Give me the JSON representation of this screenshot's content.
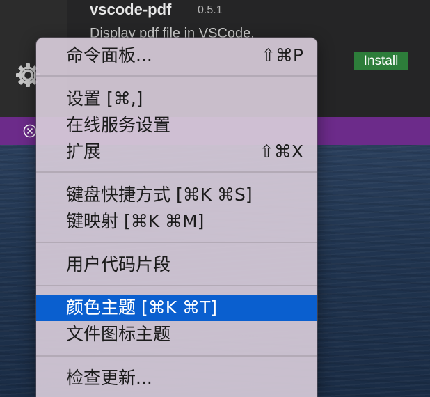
{
  "extension": {
    "name": "vscode-pdf",
    "version": "0.5.1",
    "description": "Display pdf file in VSCode.",
    "install_label": "Install"
  },
  "icons": {
    "gear": "gear-icon",
    "errors": "circle-x-icon"
  },
  "menu": {
    "items": [
      {
        "label": "命令面板...",
        "shortcut": "⇧⌘P"
      },
      {
        "label": "设置 [⌘,]",
        "shortcut": ""
      },
      {
        "label": "在线服务设置",
        "shortcut": ""
      },
      {
        "label": "扩展",
        "shortcut": "⇧⌘X"
      },
      {
        "label": "键盘快捷方式 [⌘K ⌘S]",
        "shortcut": ""
      },
      {
        "label": "键映射 [⌘K ⌘M]",
        "shortcut": ""
      },
      {
        "label": "用户代码片段",
        "shortcut": ""
      },
      {
        "label": "颜色主题 [⌘K ⌘T]",
        "shortcut": "",
        "selected": true
      },
      {
        "label": "文件图标主题",
        "shortcut": ""
      },
      {
        "label": "检查更新...",
        "shortcut": ""
      }
    ]
  },
  "colors": {
    "status_bar": "#6c2b8a",
    "menu_highlight": "#0a5fcf",
    "install_button": "#2d7d3a"
  }
}
